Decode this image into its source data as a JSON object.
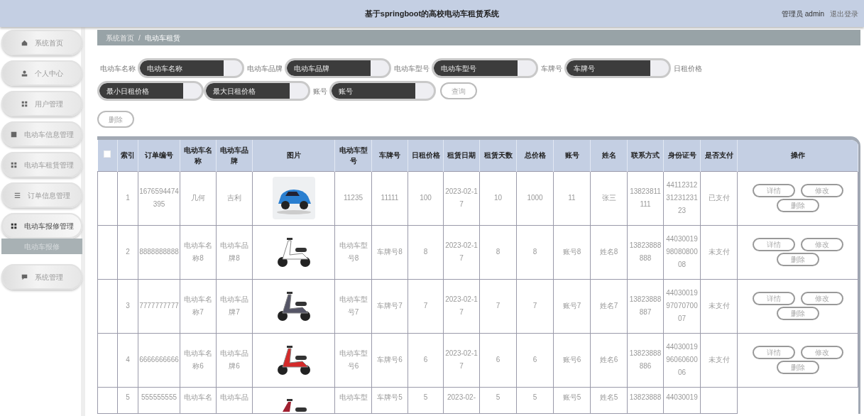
{
  "header": {
    "title": "基于springboot的高校电动车租赁系统",
    "user": "管理员 admin",
    "logout": "退出登录"
  },
  "sidebar": {
    "items": [
      {
        "label": "系统首页",
        "expanded": false
      },
      {
        "label": "个人中心",
        "expanded": false
      },
      {
        "label": "用户管理",
        "expanded": false
      },
      {
        "label": "电动车信息管理",
        "expanded": false
      },
      {
        "label": "电动车租赁管理",
        "expanded": false
      },
      {
        "label": "订单信息管理",
        "expanded": false
      },
      {
        "label": "电动车报修管理",
        "expanded": true,
        "children": [
          {
            "label": "电动车报修",
            "selected": true
          }
        ]
      },
      {
        "label": "系统管理",
        "expanded": false
      }
    ]
  },
  "breadcrumb": [
    "系统首页",
    "/",
    "电动车租赁"
  ],
  "search": {
    "fields": [
      {
        "label": "电动车名称",
        "placeholder": "电动车名称"
      },
      {
        "label": "电动车品牌",
        "placeholder": "电动车品牌"
      },
      {
        "label": "电动车型号",
        "placeholder": "电动车型号"
      },
      {
        "label": "车牌号",
        "placeholder": "车牌号"
      },
      {
        "label": "日租价格",
        "placeholder": "最小日租价格"
      },
      {
        "placeholder": "最大日租价格"
      },
      {
        "label": "账号",
        "placeholder": "账号"
      }
    ],
    "button": "查询"
  },
  "delete_button": "删除",
  "table": {
    "select_all": {
      "checked": false
    },
    "columns": [
      "索引",
      "订单编号",
      "电动车名称",
      "电动车品牌",
      "图片",
      "电动车型号",
      "车牌号",
      "日租价格",
      "租赁日期",
      "租赁天数",
      "总价格",
      "账号",
      "姓名",
      "联系方式",
      "身份证号",
      "是否支付",
      "操作"
    ],
    "rows": [
      {
        "cells": [
          "1",
          "1676594474395",
          "几何",
          "吉利",
          {
            "kind": "picture"
          },
          "11235",
          "11111",
          "100",
          "2023-02-17",
          "10",
          "1000",
          "11",
          "张三",
          "13823811111",
          "441123123123123123",
          "已支付"
        ],
        "actions": [
          "详情",
          "修改",
          "删除"
        ]
      },
      {
        "cells": [
          "2",
          "8888888888",
          "电动车名称8",
          "电动车品牌8",
          {
            "kind": "picture"
          },
          "电动车型号8",
          "车牌号8",
          "8",
          "2023-02-17",
          "8",
          "8",
          "账号8",
          "姓名8",
          "13823888888",
          "440300199808080008",
          "未支付"
        ],
        "actions": [
          "详情",
          "修改",
          "删除"
        ]
      },
      {
        "cells": [
          "3",
          "7777777777",
          "电动车名称7",
          "电动车品牌7",
          {
            "kind": "picture"
          },
          "电动车型号7",
          "车牌号7",
          "7",
          "2023-02-17",
          "7",
          "7",
          "账号7",
          "姓名7",
          "13823888887",
          "440300199707070007",
          "未支付"
        ],
        "actions": [
          "详情",
          "修改",
          "删除"
        ]
      },
      {
        "cells": [
          "4",
          "6666666666",
          "电动车名称6",
          "电动车品牌6",
          {
            "kind": "picture"
          },
          "电动车型号6",
          "车牌号6",
          "6",
          "2023-02-17",
          "6",
          "6",
          "账号6",
          "姓名6",
          "13823888886",
          "440300199606060006",
          "未支付"
        ],
        "actions": [
          "详情",
          "修改",
          "删除"
        ]
      },
      {
        "cells": [
          "5",
          "555555555",
          "电动车名",
          "电动车品",
          {
            "kind": "picture"
          },
          "电动车型",
          "车牌号5",
          "5",
          "2023-02-",
          "5",
          "5",
          "账号5",
          "姓名5",
          "13823888",
          "44030019"
        ]
      }
    ]
  }
}
